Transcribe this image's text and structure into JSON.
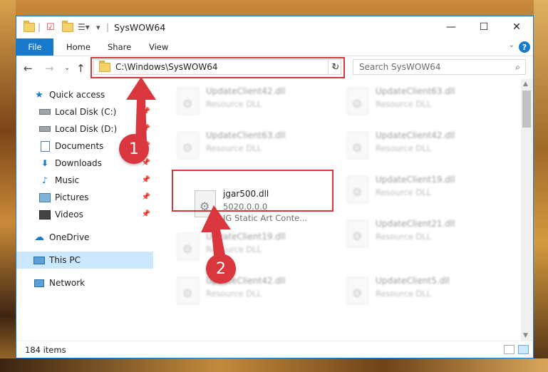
{
  "window": {
    "title": "SysWOW64",
    "minimize_glyph": "—",
    "maximize_glyph": "☐",
    "close_glyph": "✕"
  },
  "ribbon": {
    "tabs": [
      {
        "label": "File"
      },
      {
        "label": "Home"
      },
      {
        "label": "Share"
      },
      {
        "label": "View"
      }
    ],
    "help_glyph": "?"
  },
  "address_bar": {
    "path": "C:\\Windows\\SysWOW64"
  },
  "search": {
    "placeholder": "Search SysWOW64"
  },
  "nav_pane": {
    "items": [
      {
        "label": "Quick access",
        "icon": "star-icon"
      },
      {
        "label": "Local Disk (C:)",
        "icon": "drive-icon"
      },
      {
        "label": "Local Disk (D:)",
        "icon": "drive-icon"
      },
      {
        "label": "Documents",
        "icon": "documents-icon"
      },
      {
        "label": "Downloads",
        "icon": "download-icon"
      },
      {
        "label": "Music",
        "icon": "music-icon"
      },
      {
        "label": "Pictures",
        "icon": "pictures-icon"
      },
      {
        "label": "Videos",
        "icon": "videos-icon"
      },
      {
        "label": "OneDrive",
        "icon": "cloud-icon"
      },
      {
        "label": "This PC",
        "icon": "computer-icon"
      },
      {
        "label": "Network",
        "icon": "network-icon"
      }
    ]
  },
  "files": [
    {
      "name": "UpdateClient42.dll",
      "line1": "Resource DLL",
      "line2": ""
    },
    {
      "name": "UpdateClient63.dll",
      "line1": "Resource DLL",
      "line2": ""
    },
    {
      "name": "UpdateClient63.dll",
      "line1": "Resource DLL",
      "line2": ""
    },
    {
      "name": "UpdateClient42.dll",
      "line1": "Resource DLL",
      "line2": ""
    },
    {
      "name": "jgar500.dll",
      "line1": "5020.0.0.0",
      "line2": "JG Static Art Conte..."
    },
    {
      "name": "UpdateClient19.dll",
      "line1": "Resource DLL",
      "line2": ""
    },
    {
      "name": "UpdateClient19.dll",
      "line1": "Resource DLL",
      "line2": ""
    },
    {
      "name": "UpdateClient21.dll",
      "line1": "Resource DLL",
      "line2": ""
    },
    {
      "name": "UpdateClient42.dll",
      "line1": "Resource DLL",
      "line2": ""
    },
    {
      "name": "UpdateClient5.dll",
      "line1": "Resource DLL",
      "line2": ""
    }
  ],
  "status": {
    "item_count": "184 items"
  },
  "markers": [
    {
      "label": "1"
    },
    {
      "label": "2"
    }
  ],
  "colors": {
    "accent": "#1979ca",
    "highlight_red": "#d9363e",
    "selection": "#cce8ff"
  }
}
